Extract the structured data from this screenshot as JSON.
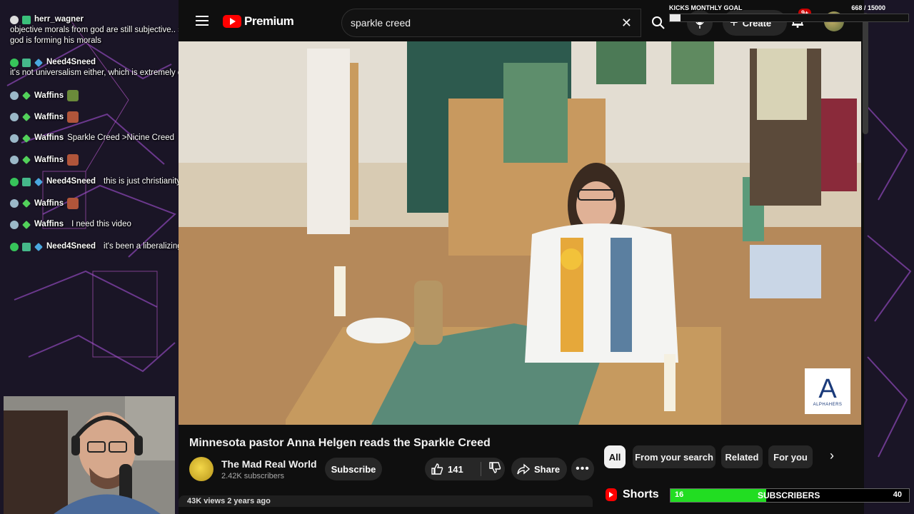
{
  "chat": {
    "messages": [
      {
        "user": "herr_wagner",
        "text": "objective morals from god are still subjective.. subjective from god. we dont know how god is forming his morals",
        "name_color": "#ffffff",
        "badges": [
          "smiley"
        ]
      },
      {
        "user": "Need4Sneed",
        "text": "it's not universalism either, which is extremely dangerous and liberal",
        "name_color": "#ffffff",
        "badges": [
          "green-circle",
          "sword"
        ]
      },
      {
        "user": "Waffins",
        "text": "",
        "name_color": "#ffffff",
        "badges": [
          "globe",
          "diamond"
        ],
        "emote": "#6a8a3a"
      },
      {
        "user": "Waffins",
        "text": "",
        "name_color": "#ffffff",
        "badges": [
          "globe",
          "diamond"
        ],
        "emote": "#b0553a"
      },
      {
        "user": "Waffins",
        "text": "Sparkle Creed >Nicine Creed",
        "name_color": "#ffffff",
        "badges": [
          "globe",
          "diamond"
        ]
      },
      {
        "user": "Waffins",
        "text": "",
        "name_color": "#ffffff",
        "badges": [
          "globe",
          "diamond"
        ],
        "emote": "#b0553a"
      },
      {
        "user": "Need4Sneed",
        "text": "this is just christianity",
        "name_color": "#ffffff",
        "badges": [
          "green-circle",
          "sword"
        ]
      },
      {
        "user": "Waffins",
        "text": "",
        "name_color": "#ffffff",
        "badges": [
          "globe",
          "diamond"
        ],
        "emote": "#b0553a"
      },
      {
        "user": "Waffins",
        "text": "I need this video",
        "name_color": "#ffffff",
        "badges": [
          "globe",
          "diamond"
        ]
      },
      {
        "user": "Need4Sneed",
        "text": "it's been a liberalizing force since its inception",
        "name_color": "#ffffff",
        "badges": [
          "green-circle",
          "sword"
        ]
      }
    ]
  },
  "youtube": {
    "logo_text": "Premium",
    "search": {
      "value": "sparkle creed"
    },
    "create_label": "Create",
    "notif_badge": "9+",
    "video_title": "Minnesota pastor Anna Helgen reads the Sparkle Creed",
    "channel": {
      "name": "The Mad Real World",
      "subscribers": "2.42K subscribers"
    },
    "subscribe_label": "Subscribe",
    "likes": "141",
    "share_label": "Share",
    "views_line": "43K views  2 years ago",
    "watermark_letter": "A",
    "watermark_text": "ALPHAHERS",
    "chips": [
      "All",
      "From your search",
      "Related",
      "For you"
    ],
    "shorts_label": "Shorts"
  },
  "widgets": {
    "goal": {
      "label": "KICKS MONTHLY GOAL",
      "current": "668",
      "max": "15000",
      "progress": 0.045
    },
    "subs": {
      "current": "16",
      "label": "SUBSCRIBERS",
      "target": "40",
      "progress": 0.4,
      "bar_color": "#22dd22"
    }
  },
  "colors": {
    "bg": "#0f0f0f",
    "chip_active": "#f1f1f1",
    "pill": "#272727",
    "yt_red": "#ff0000"
  }
}
